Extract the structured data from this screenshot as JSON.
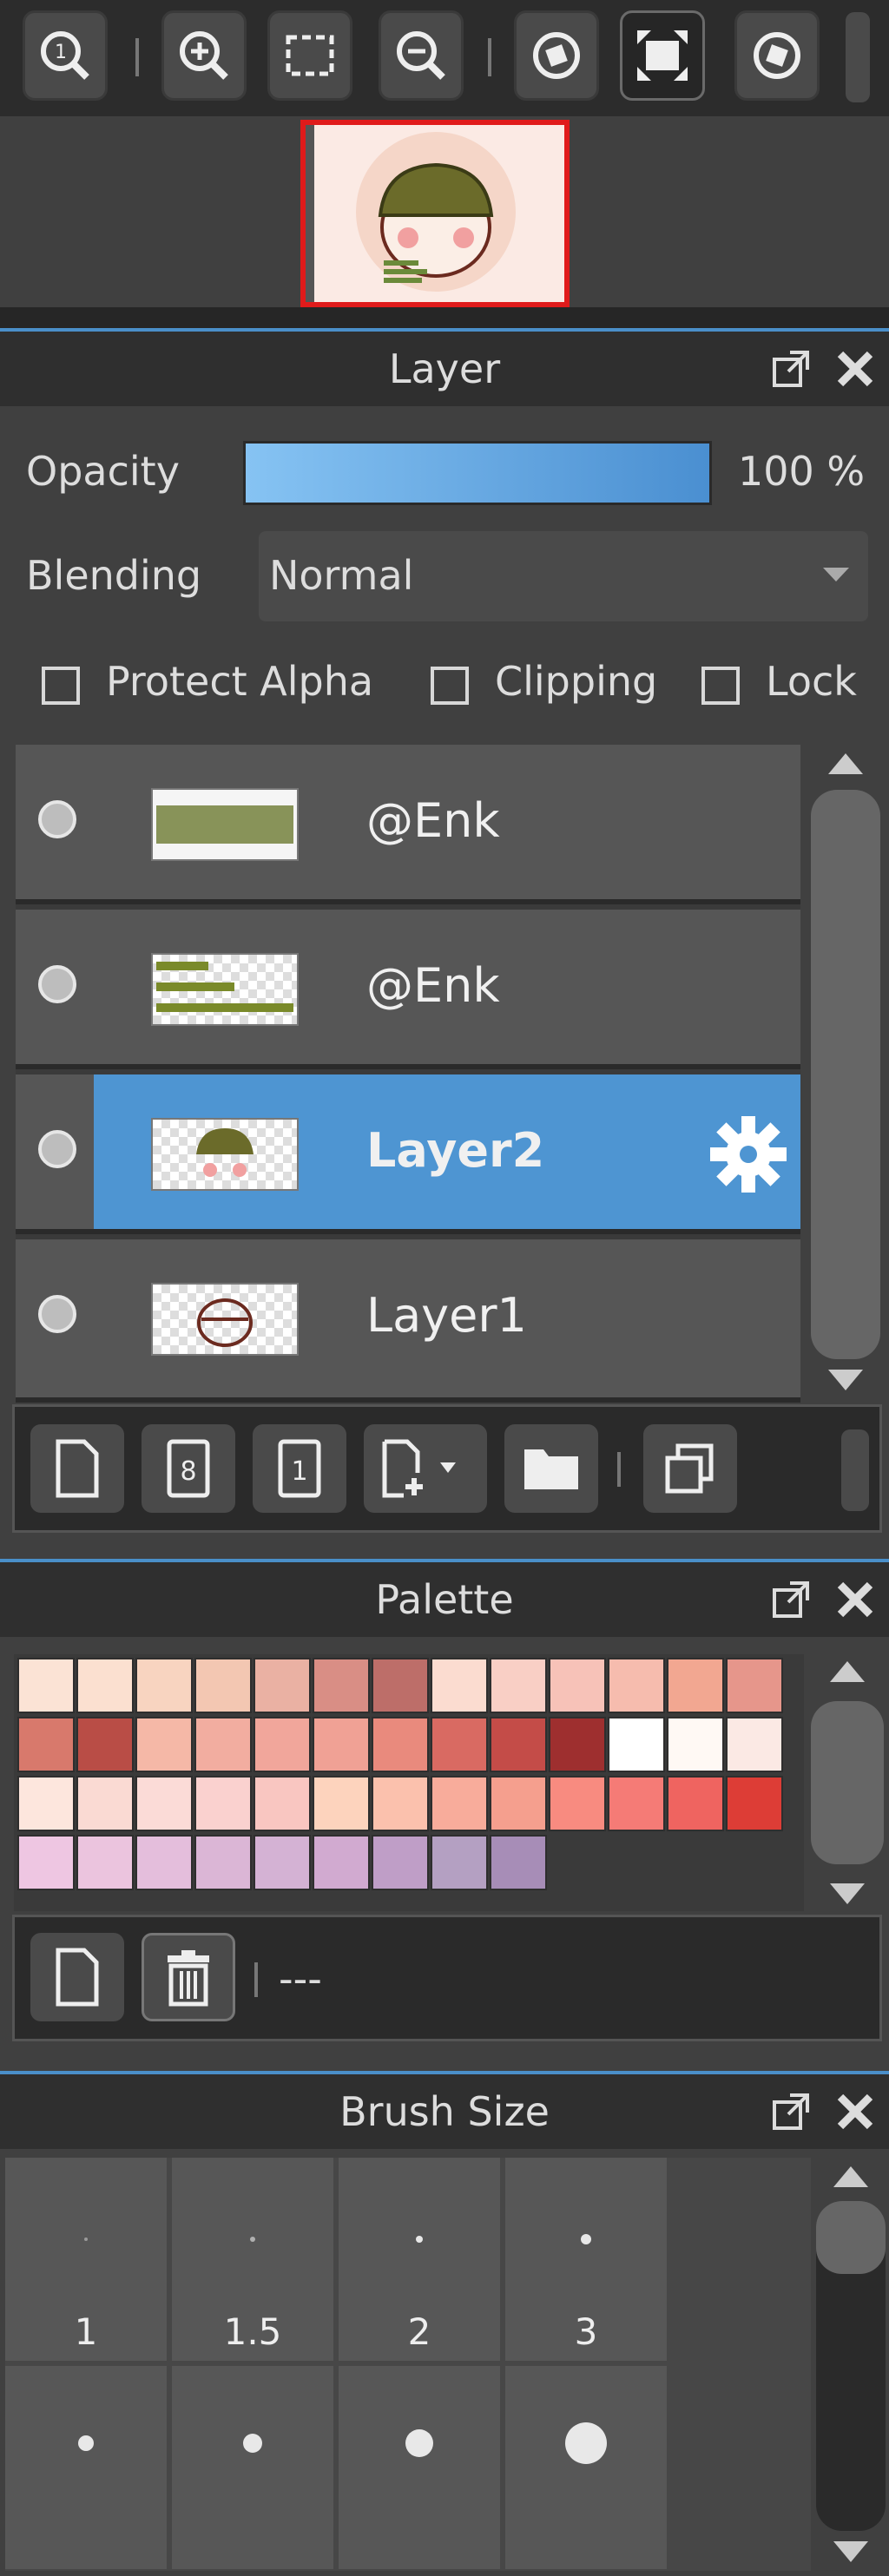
{
  "layer_panel": {
    "title": "Layer",
    "opacity_label": "Opacity",
    "opacity_value": "100 %",
    "opacity_fraction": 1.0,
    "blending_label": "Blending",
    "blending_value": "Normal",
    "checkboxes": [
      {
        "label": "Protect Alpha",
        "checked": false
      },
      {
        "label": "Clipping",
        "checked": false
      },
      {
        "label": "Lock",
        "checked": false
      }
    ],
    "layers": [
      {
        "name": "@Enk",
        "selected": false
      },
      {
        "name": "@Enk",
        "selected": false
      },
      {
        "name": "Layer2",
        "selected": true
      },
      {
        "name": "Layer1",
        "selected": false
      }
    ]
  },
  "palette_panel": {
    "title": "Palette",
    "palette_name": "---",
    "swatch_rows": [
      [
        "#fbe3d5",
        "#fbe0d0",
        "#f8d4c0",
        "#f3c7b2",
        "#eab1a3",
        "#d98e85",
        "#bd6e69",
        "#fbdcd0",
        "#f9cfc5",
        "#f7c2b8",
        "#f6bcae",
        "#f2a791",
        "#e6968b"
      ],
      [
        "#d8796c",
        "#b94d46",
        "#f5b8a7",
        "#f2ada0",
        "#f1a69b",
        "#f0a195",
        "#e98a7d",
        "#d96a62",
        "#c44c48",
        "#9e2f2f",
        "#ffffff",
        "#fff9f4",
        "#fbe9e4"
      ],
      [
        "#fde6dd",
        "#fadad3",
        "#fbdbd7",
        "#fad1cf",
        "#f9c6c1",
        "#fdd3bd",
        "#fbc1ad",
        "#f8ac9b",
        "#f59f8e",
        "#f88b80",
        "#f57b76",
        "#ef6460",
        "#dd3d36"
      ],
      [
        "#eec6e2",
        "#ebc4de",
        "#e4bedc",
        "#dbb6d6",
        "#d4b2d4",
        "#d1aad0",
        "#bf9ec7",
        "#b4a0c2",
        "#a78db7"
      ]
    ]
  },
  "brush_panel": {
    "title": "Brush Size",
    "sizes": [
      "1",
      "1.5",
      "2",
      "3"
    ]
  }
}
